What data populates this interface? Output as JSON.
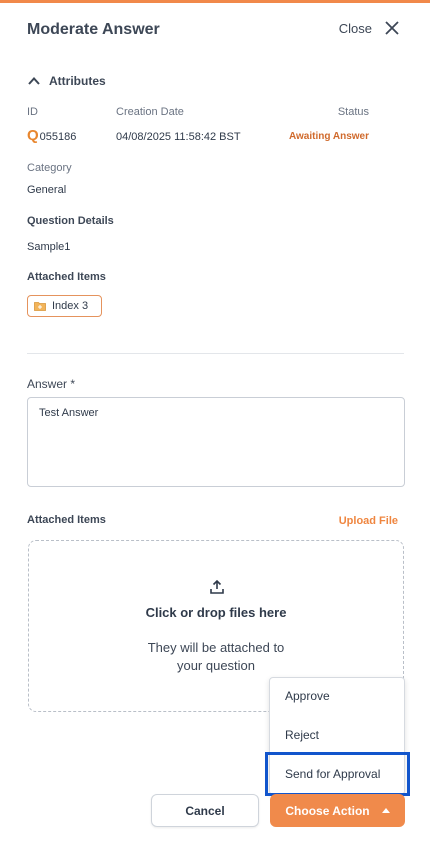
{
  "header": {
    "title": "Moderate Answer",
    "close_label": "Close"
  },
  "attributes": {
    "toggle_label": "Attributes",
    "id_label": "ID",
    "id_prefix": "Q",
    "id_number": "055186",
    "creation_label": "Creation Date",
    "creation_value": "04/08/2025 11:58:42 BST",
    "status_label": "Status",
    "status_value": "Awaiting Answer",
    "category_label": "Category",
    "category_value": "General",
    "question_label": "Question Details",
    "question_value": "Sample1",
    "attached_label": "Attached Items",
    "attached_chip": "Index 3"
  },
  "answer": {
    "label": "Answer *",
    "value": "Test Answer"
  },
  "attachments": {
    "label": "Attached Items",
    "upload_link": "Upload File",
    "drop_title": "Click or drop files here",
    "drop_sub_line1": "They will be attached to",
    "drop_sub_line2": "your question"
  },
  "menu": {
    "items": [
      "Approve",
      "Reject",
      "Send for Approval"
    ]
  },
  "footer": {
    "cancel_label": "Cancel",
    "action_label": "Choose Action"
  },
  "colors": {
    "accent": "#f08a4b",
    "status": "#d06a2c",
    "highlight": "#1155cc"
  }
}
